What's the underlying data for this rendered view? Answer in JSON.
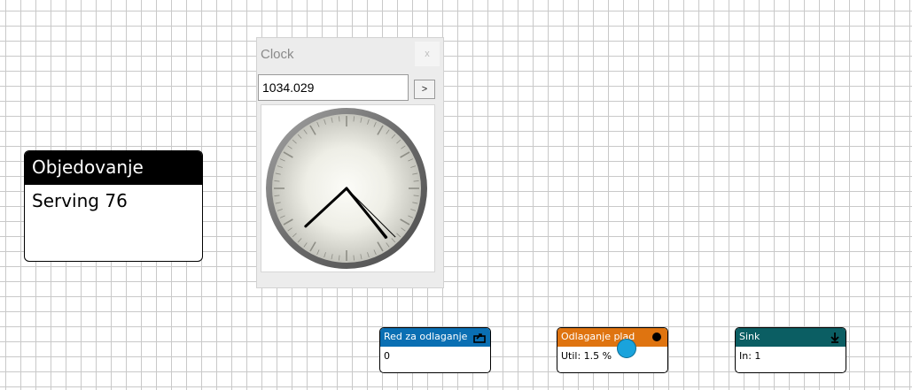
{
  "blocks": {
    "objedovanje": {
      "title": "Objedovanje",
      "status": "Serving 76",
      "header_color": "#000000"
    },
    "red": {
      "title": "Red za odlaganje",
      "value": "0",
      "header_color": "#0a6fb3",
      "icon": "export-icon"
    },
    "odlaganje": {
      "title": "Odlaganje plad",
      "value": "Util: 1.5 %",
      "header_color": "#df7410",
      "icon": "dot-icon",
      "token_color": "#1aa3dc"
    },
    "sink": {
      "title": "Sink",
      "value": "In: 1",
      "header_color": "#0b5e63",
      "icon": "arrow-down-icon"
    }
  },
  "clock": {
    "title": "Clock",
    "close_label": "x",
    "time_value": "1034.029",
    "go_label": ">",
    "hands": {
      "hour": 7.57,
      "minute": 23.5,
      "second": 22.5
    }
  },
  "colors": {
    "grid": "#c9c9c9"
  }
}
